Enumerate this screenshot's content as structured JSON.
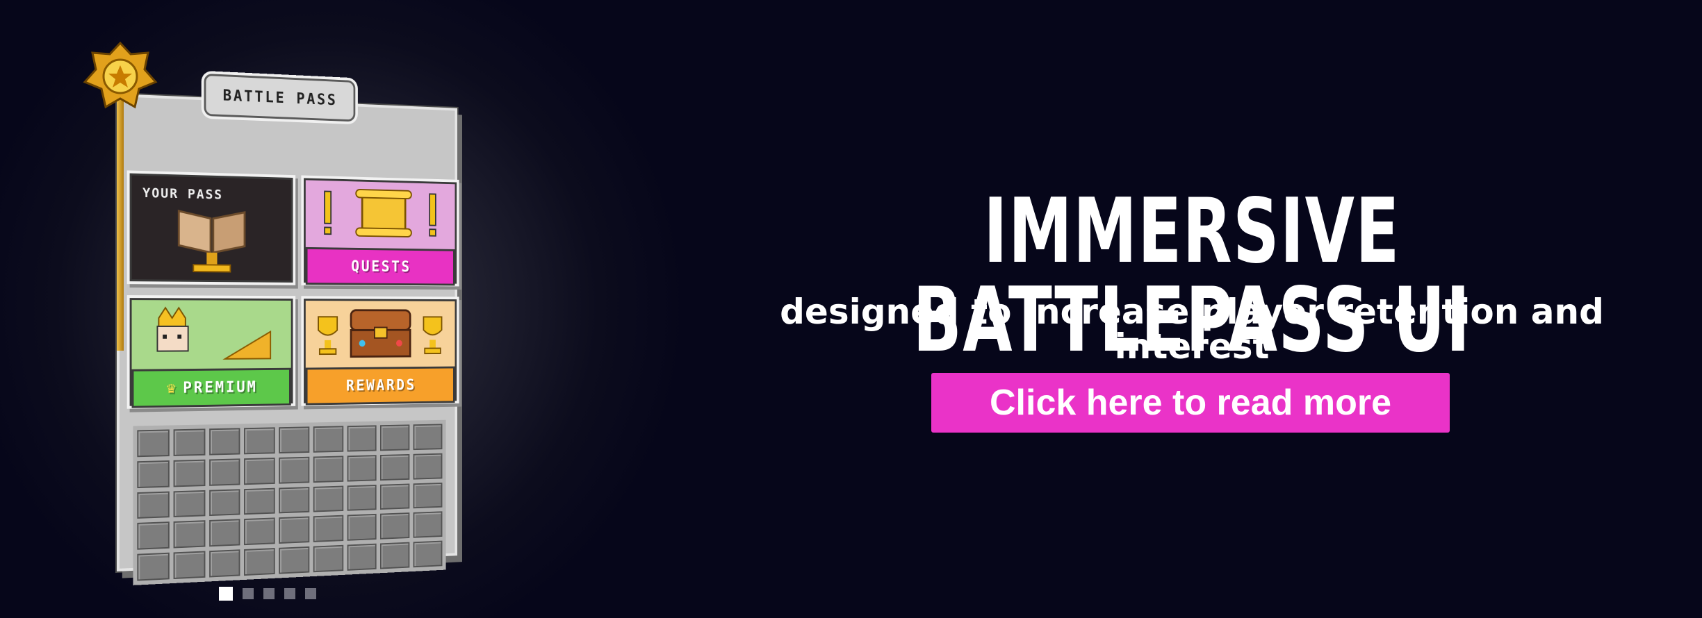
{
  "hero": {
    "headline": "IMMERSIVE BATTLEPASS UI",
    "subheadline": "designed to increase player retention and interest",
    "cta_label": "Click here to read more",
    "cta_color": "#ea33c8"
  },
  "battle_pass": {
    "title": "BATTLE PASS",
    "cards": {
      "your_pass": "YOUR PASS",
      "quests": "QUESTS",
      "premium": "PREMIUM",
      "rewards": "REWARDS"
    },
    "colors": {
      "quests": "#e832c3",
      "premium": "#5dc84a",
      "rewards": "#f7a02a",
      "pole": "#f0c14a"
    }
  },
  "carousel": {
    "total_slides": 5,
    "active_slide": 1
  }
}
